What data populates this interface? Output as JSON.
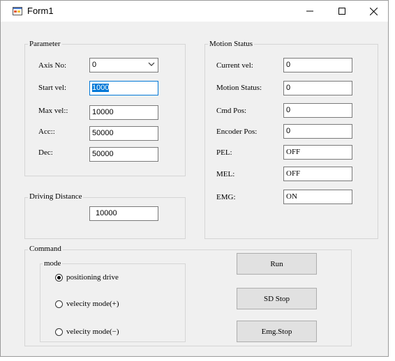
{
  "window": {
    "title": "Form1"
  },
  "parameter": {
    "title": "Parameter",
    "axis_no": {
      "label": "Axis No:",
      "value": "0"
    },
    "start_vel": {
      "label": "Start vel:",
      "value": "1000"
    },
    "max_vel": {
      "label": "Max vel::",
      "value": "10000"
    },
    "acc": {
      "label": "Acc::",
      "value": "50000"
    },
    "dec": {
      "label": "Dec:",
      "value": "50000"
    }
  },
  "driving_distance": {
    "title": "Driving Distance",
    "value": "10000"
  },
  "motion_status": {
    "title": "Motion Status",
    "current_vel": {
      "label": "Current vel:",
      "value": "0"
    },
    "motion_status": {
      "label": "Motion Status:",
      "value": "0"
    },
    "cmd_pos": {
      "label": "Cmd Pos:",
      "value": "0"
    },
    "encoder_pos": {
      "label": "Encoder Pos:",
      "value": "0"
    },
    "pel": {
      "label": "PEL:",
      "value": "OFF"
    },
    "mel": {
      "label": "MEL:",
      "value": "OFF"
    },
    "emg": {
      "label": "EMG:",
      "value": "ON"
    }
  },
  "command": {
    "title": "Command",
    "mode": {
      "title": "mode",
      "options": [
        "positioning drive",
        "velecity mode(+)",
        "velecity mode(−)"
      ],
      "selected": "positioning drive"
    },
    "buttons": {
      "run": "Run",
      "sd_stop": "SD Stop",
      "emg_stop": "Emg.Stop"
    }
  }
}
